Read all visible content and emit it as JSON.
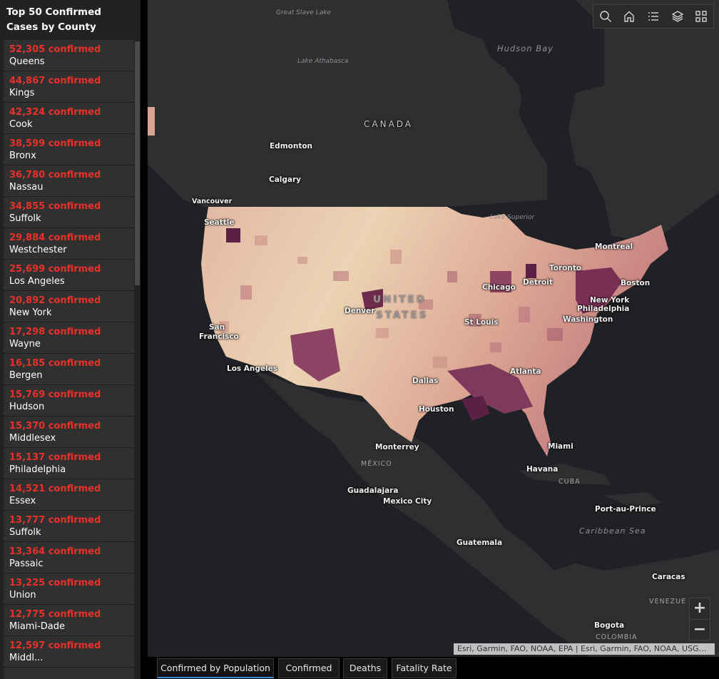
{
  "panel": {
    "title": "Top 50 Confirmed Cases by County",
    "items": [
      {
        "count": "52,305 confirmed",
        "county": "Queens"
      },
      {
        "count": "44,867 confirmed",
        "county": "Kings"
      },
      {
        "count": "42,324 confirmed",
        "county": "Cook"
      },
      {
        "count": "38,599 confirmed",
        "county": "Bronx"
      },
      {
        "count": "36,780 confirmed",
        "county": "Nassau"
      },
      {
        "count": "34,855 confirmed",
        "county": "Suffolk"
      },
      {
        "count": "29,884 confirmed",
        "county": "Westchester"
      },
      {
        "count": "25,699 confirmed",
        "county": "Los Angeles"
      },
      {
        "count": "20,892 confirmed",
        "county": "New York"
      },
      {
        "count": "17,298 confirmed",
        "county": "Wayne"
      },
      {
        "count": "16,185 confirmed",
        "county": "Bergen"
      },
      {
        "count": "15,769 confirmed",
        "county": "Hudson"
      },
      {
        "count": "15,370 confirmed",
        "county": "Middlesex"
      },
      {
        "count": "15,137 confirmed",
        "county": "Philadelphia"
      },
      {
        "count": "14,521 confirmed",
        "county": "Essex"
      },
      {
        "count": "13,777 confirmed",
        "county": "Suffolk"
      },
      {
        "count": "13,364 confirmed",
        "county": "Passaic"
      },
      {
        "count": "13,225 confirmed",
        "county": "Union"
      },
      {
        "count": "12,775 confirmed",
        "county": "Miami-Dade"
      },
      {
        "count": "12,597 confirmed",
        "county": "Middl..."
      }
    ]
  },
  "map": {
    "labels": {
      "great_slave_lake": "Great Slave Lake",
      "lake_athabasca": "Lake Athabasca",
      "hudson_bay": "Hudson Bay",
      "canada": "CANADA",
      "edmonton": "Edmonton",
      "calgary": "Calgary",
      "vancouver": "Vancouver",
      "seattle": "Seattle",
      "lake_superior": "Lake Superior",
      "montreal": "Montreal",
      "toronto": "Toronto",
      "detroit": "Detroit",
      "chicago": "Chicago",
      "boston": "Boston",
      "new_york": "New York",
      "philadelphia": "Philadelphia",
      "washington": "Washington",
      "united": "UNITED",
      "states": "STATES",
      "denver": "Denver",
      "st_louis": "St Louis",
      "san_francisco": "San Francisco",
      "los_angeles": "Los Angeles",
      "dallas": "Dallas",
      "atlanta": "Atlanta",
      "houston": "Houston",
      "miami": "Miami",
      "monterrey": "Monterrey",
      "mexico": "MÉXICO",
      "havana": "Havana",
      "cuba": "CUBA",
      "guadalajara": "Guadalajara",
      "mexico_city": "Mexico City",
      "port_au_prince": "Port-au-Prince",
      "caribbean_sea": "Caribbean Sea",
      "guatemala": "Guatemala",
      "caracas": "Caracas",
      "venezuela": "VENEZUE",
      "bogota": "Bogota",
      "colombia": "COLOMBIA"
    },
    "attribution": "Esri, Garmin, FAO, NOAA, EPA | Esri, Garmin, FAO, NOAA, USGS, EPA",
    "zoom_in": "+",
    "zoom_out": "−",
    "toolbar_icons": [
      "search-icon",
      "home-icon",
      "legend-list-icon",
      "layers-icon",
      "basemap-gallery-icon"
    ],
    "colors": {
      "background": "#202124",
      "land": "#2f2f31",
      "low": "#ecd3b4",
      "mid": "#d59a8a",
      "high": "#a8596c",
      "highest": "#5c1f45"
    }
  },
  "tabs": [
    {
      "label": "Confirmed by Population",
      "active": true
    },
    {
      "label": "Confirmed",
      "active": false
    },
    {
      "label": "Deaths",
      "active": false
    },
    {
      "label": "Fatality Rate",
      "active": false
    }
  ]
}
